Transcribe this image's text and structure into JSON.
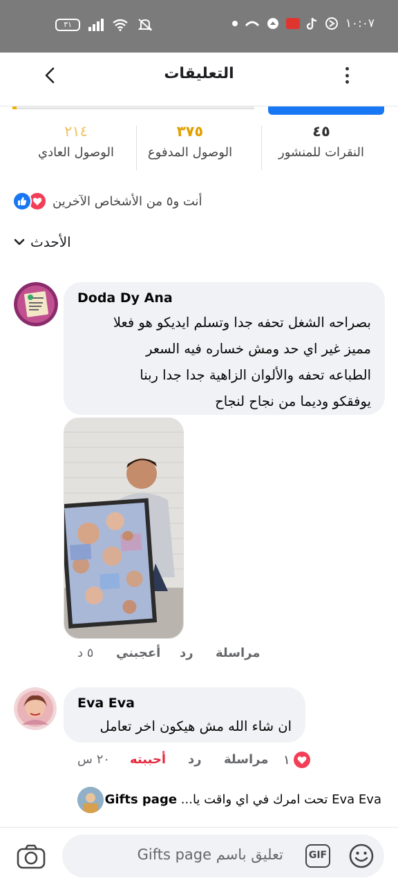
{
  "status_bar": {
    "time": "١٠:٠٧",
    "battery": "٣١"
  },
  "header": {
    "title": "التعليقات"
  },
  "stats": [
    {
      "value": "٤٥",
      "label": "النقرات للمنشور"
    },
    {
      "value": "٣٧٥",
      "label": "الوصول المدفوع"
    },
    {
      "value": "٢١٤",
      "label": "الوصول العادي"
    }
  ],
  "reactions": {
    "summary": "أنت و٥ من الأشخاص الآخرين"
  },
  "sort": {
    "label": "الأحدث"
  },
  "comments": [
    {
      "author": "Doda Dy Ana",
      "lines": [
        "بصراحه الشغل تحفه جدا وتسلم ايديكو هو فعلا",
        "مميز غير اي حد  ومش خساره فيه السعر",
        "الطباعه تحفه والألوان الزاهية جدا جدا ربنا",
        "يوفقكو وديما من نجاح لنجاح"
      ],
      "actions": {
        "message": "مراسلة",
        "reply": "رد",
        "like": "أعجبني",
        "time": "٥ د"
      }
    },
    {
      "author": "Eva Eva",
      "lines": [
        "ان شاء الله مش هيكون اخر تعامل"
      ],
      "actions": {
        "reaction_count": "١",
        "message": "مراسلة",
        "reply": "رد",
        "like": "أحببته",
        "time": "٢٠ س"
      },
      "reply_preview": {
        "author": "Gifts page",
        "text": "Eva Eva تحت امرك في اي واقت يا..."
      }
    }
  ],
  "composer": {
    "placeholder": "تعليق باسم Gifts page",
    "gif_label": "GIF"
  },
  "colors": {
    "accent_blue": "#1877f2",
    "love_red": "#f33e58",
    "paid_reach": "#e0a000",
    "organic_reach": "#f0c060"
  }
}
